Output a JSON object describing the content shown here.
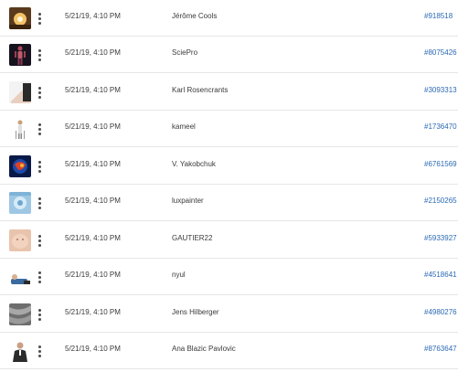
{
  "rows": [
    {
      "date": "5/21/19, 4:10 PM",
      "author": "Jérôme Cools",
      "id": "#918518"
    },
    {
      "date": "5/21/19, 4:10 PM",
      "author": "SciePro",
      "id": "#8075426"
    },
    {
      "date": "5/21/19, 4:10 PM",
      "author": "Karl Rosencrants",
      "id": "#3093313"
    },
    {
      "date": "5/21/19, 4:10 PM",
      "author": "kameel",
      "id": "#1736470"
    },
    {
      "date": "5/21/19, 4:10 PM",
      "author": "V. Yakobchuk",
      "id": "#6761569"
    },
    {
      "date": "5/21/19, 4:10 PM",
      "author": "luxpainter",
      "id": "#2150265"
    },
    {
      "date": "5/21/19, 4:10 PM",
      "author": "GAUTIER22",
      "id": "#5933927"
    },
    {
      "date": "5/21/19, 4:10 PM",
      "author": "nyul",
      "id": "#4518641"
    },
    {
      "date": "5/21/19, 4:10 PM",
      "author": "Jens Hilberger",
      "id": "#4980276"
    },
    {
      "date": "5/21/19, 4:10 PM",
      "author": "Ana Blazic Pavlovic",
      "id": "#8763647"
    }
  ]
}
